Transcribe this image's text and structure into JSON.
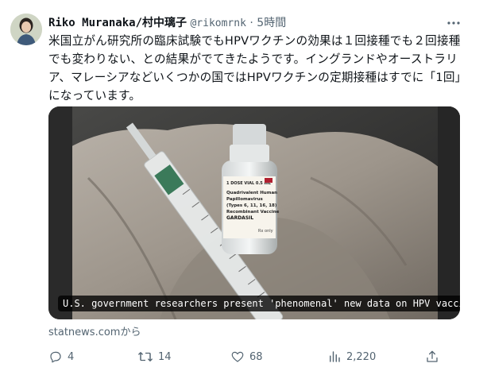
{
  "tweet": {
    "display_name": "Riko Muranaka/村中璃子",
    "handle": "@rikomrnk",
    "separator": "·",
    "time": "5時間",
    "text": "米国立がん研究所の臨床試験でもHPVワクチンの効果は１回接種でも２回接種でも変わりない、との結果がでてきたようです。イングランドやオーストラリア、マレーシアなどいくつかの国ではHPVワクチンの定期接種はすでに「1回」になっています。",
    "card": {
      "caption": "U.S. government researchers present 'phenomenal' new data on HPV vaccines",
      "vial_label_lines": [
        "1 DOSE VIAL 0.5 mL",
        "Quadrivalent Human",
        "Papillomavirus",
        "(Types 6, 11, 16, 18)",
        "Recombinant Vaccine",
        "GARDASIL",
        "Rx only"
      ]
    },
    "source": "statnews.comから",
    "actions": {
      "replies": "4",
      "retweets": "14",
      "likes": "68",
      "views": "2,220"
    }
  },
  "icons": {
    "more": "more-horizontal-icon",
    "reply": "reply-icon",
    "retweet": "retweet-icon",
    "like": "heart-icon",
    "views": "views-chart-icon",
    "share": "share-icon"
  },
  "colors": {
    "text": "#0f1419",
    "secondary": "#536471",
    "background": "#ffffff"
  }
}
